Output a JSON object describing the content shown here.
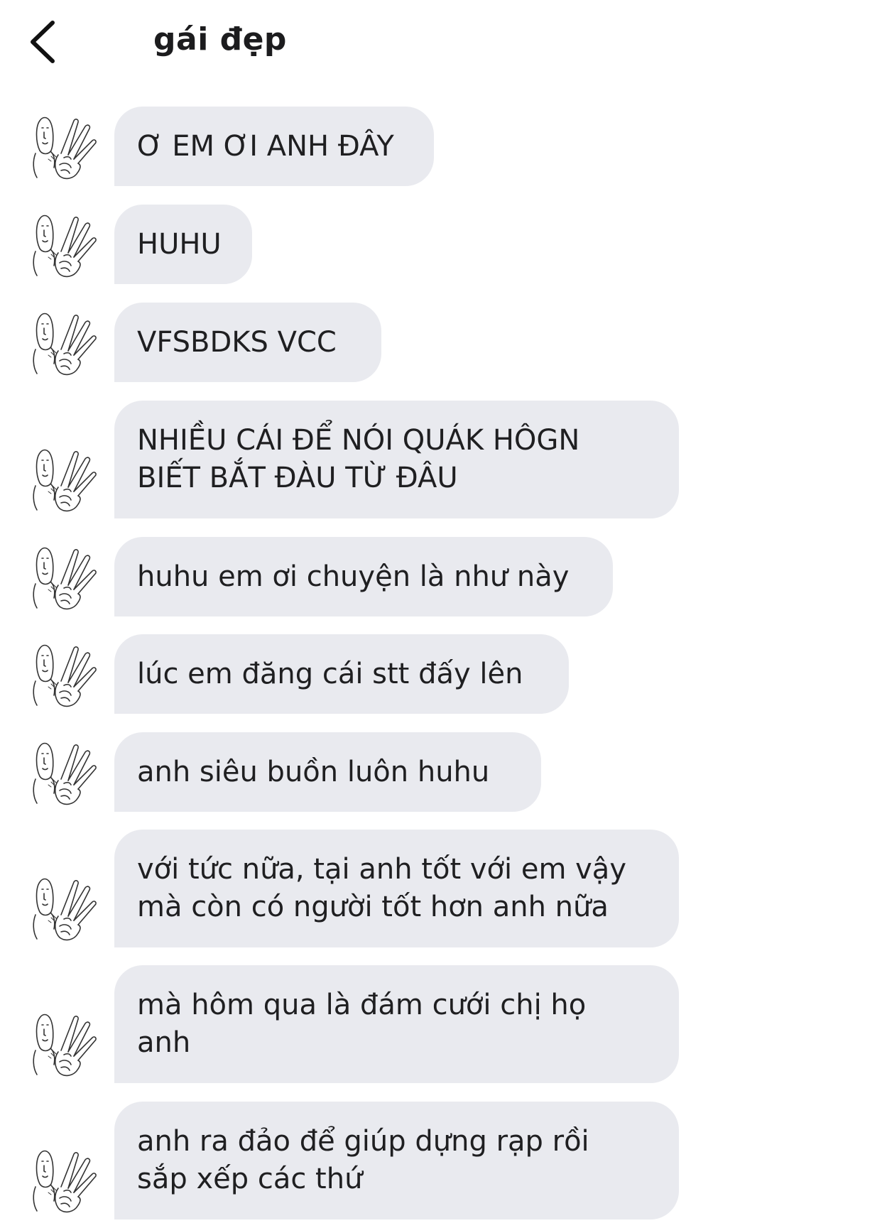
{
  "header": {
    "title": "gái đẹp"
  },
  "messages": [
    {
      "text": "Ơ EM ƠI ANH ĐÂY"
    },
    {
      "text": "HUHU"
    },
    {
      "text": "VFSBDKS VCC"
    },
    {
      "text": "NHIỀU CÁI ĐỂ NÓI QUÁK HÔGN\nBIẾT BẮT ĐÀU TỪ ĐÂU"
    },
    {
      "text": "huhu em ơi chuyện là như này"
    },
    {
      "text": "lúc em đăng cái stt đấy lên"
    },
    {
      "text": "anh siêu buồn luôn huhu"
    },
    {
      "text": "với tức nữa, tại anh tốt với em vậy\nmà còn có người tốt hơn anh nữa"
    },
    {
      "text": "mà hôm qua là đám cưới chị họ\nanh"
    },
    {
      "text": "anh ra đảo để giúp dựng rạp rồi\nsắp xếp các thứ"
    }
  ],
  "colors": {
    "bubble": "#e9eaef",
    "text": "#1f1f21",
    "background": "#ffffff"
  },
  "icons": {
    "back": "chevron-left-icon",
    "avatar": "peace-sign-meme-avatar"
  }
}
